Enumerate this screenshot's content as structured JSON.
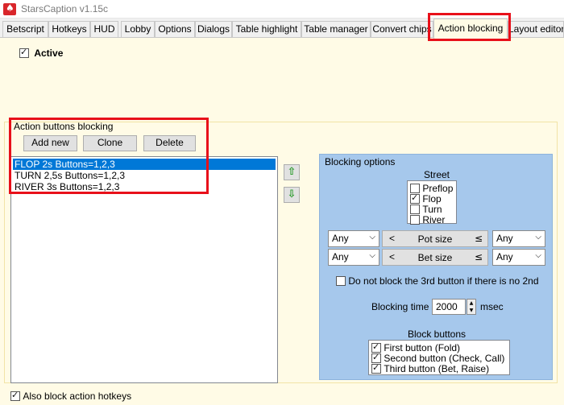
{
  "window": {
    "title": "StarsCaption v1.15c"
  },
  "tabs": [
    {
      "label": "Betscript"
    },
    {
      "label": "Hotkeys"
    },
    {
      "label": "HUD"
    },
    {
      "label": "Lobby"
    },
    {
      "label": "Options"
    },
    {
      "label": "Dialogs"
    },
    {
      "label": "Table highlight"
    },
    {
      "label": "Table manager"
    },
    {
      "label": "Convert chips"
    },
    {
      "label": "Action blocking"
    },
    {
      "label": "Layout editor"
    }
  ],
  "active_tab": "Action blocking",
  "active_checkbox": {
    "label": "Active",
    "checked": true
  },
  "action_buttons": {
    "title": "Action buttons blocking",
    "add_new": "Add new",
    "clone": "Clone",
    "delete": "Delete",
    "items": [
      {
        "label": "FLOP 2s Buttons=1,2,3",
        "selected": true
      },
      {
        "label": "TURN 2,5s Buttons=1,2,3",
        "selected": false
      },
      {
        "label": "RIVER 3s Buttons=1,2,3",
        "selected": false
      }
    ],
    "move_up": "⇧",
    "move_down": "⇩"
  },
  "blocking_options": {
    "title": "Blocking options",
    "street_label": "Street",
    "streets": [
      {
        "label": "Preflop",
        "checked": false
      },
      {
        "label": "Flop",
        "checked": true
      },
      {
        "label": "Turn",
        "checked": false
      },
      {
        "label": "River",
        "checked": false
      }
    ],
    "pot_size": {
      "left": "Any",
      "lt": "<",
      "label": "Pot size",
      "le": "≤",
      "right": "Any"
    },
    "bet_size": {
      "left": "Any",
      "lt": "<",
      "label": "Bet size",
      "le": "≤",
      "right": "Any"
    },
    "no_third_button": {
      "label": "Do not block the 3rd button if there is no 2nd",
      "checked": false
    },
    "blocking_time": {
      "label": "Blocking time",
      "value": "2000",
      "unit": "msec"
    },
    "block_buttons_label": "Block buttons",
    "block_buttons": [
      {
        "label": "First button (Fold)",
        "checked": true
      },
      {
        "label": "Second button (Check, Call)",
        "checked": true
      },
      {
        "label": "Third button (Bet, Raise)",
        "checked": true
      }
    ]
  },
  "also_block_hotkeys": {
    "label": "Also block action hotkeys",
    "checked": true
  },
  "colors": {
    "highlight": "#e8101a",
    "panel_blue": "#a6c8ec",
    "selection": "#0078d7",
    "arrow_green": "#2a9a2a"
  }
}
